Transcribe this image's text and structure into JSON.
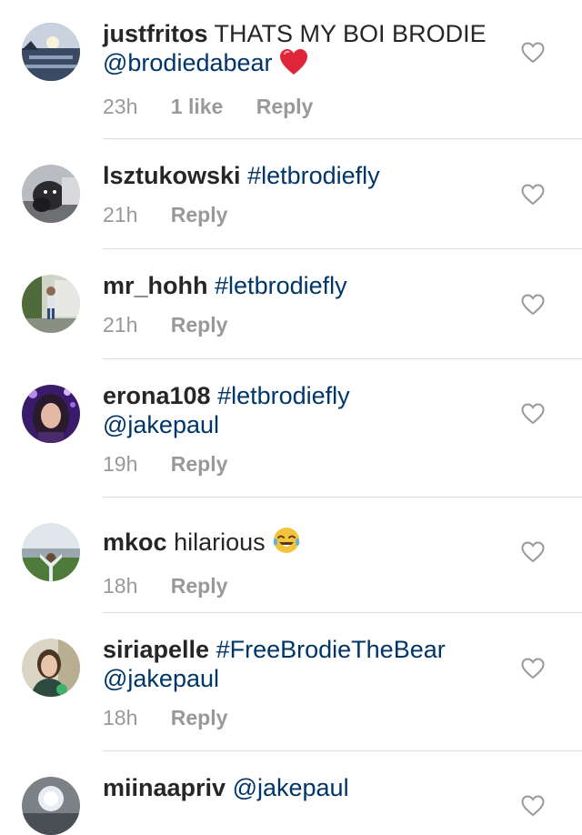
{
  "comments": [
    {
      "username": "justfritos",
      "text_before": "THATS MY BOI BRODIE ",
      "tag": "@brodiedabear",
      "emoji": "red-heart-emoji",
      "time": "23h",
      "likes": "1 like",
      "reply": "Reply"
    },
    {
      "username": "lsztukowski",
      "text_before": "",
      "tag": "#letbrodiefly",
      "time": "21h",
      "reply": "Reply"
    },
    {
      "username": "mr_hohh",
      "text_before": "",
      "tag": "#letbrodiefly",
      "time": "21h",
      "reply": "Reply"
    },
    {
      "username": "erona108",
      "text_before": "",
      "tag": "#letbrodiefly",
      "tag2": "@jakepaul",
      "time": "19h",
      "reply": "Reply"
    },
    {
      "username": "mkoc",
      "text_before": "hilarious ",
      "emoji": "tears-of-joy-emoji",
      "time": "18h",
      "reply": "Reply"
    },
    {
      "username": "siriapelle",
      "text_before": "",
      "tag": "#FreeBrodieTheBear",
      "tag2": "@jakepaul",
      "time": "18h",
      "reply": "Reply"
    },
    {
      "username": "miinaapriv",
      "text_before": "",
      "tag": "@jakepaul"
    }
  ],
  "icons": {
    "like": "heart-outline-icon"
  },
  "colors": {
    "username": "#262626",
    "tag": "#003569",
    "meta": "#999999",
    "divider": "#dbdbdb"
  }
}
